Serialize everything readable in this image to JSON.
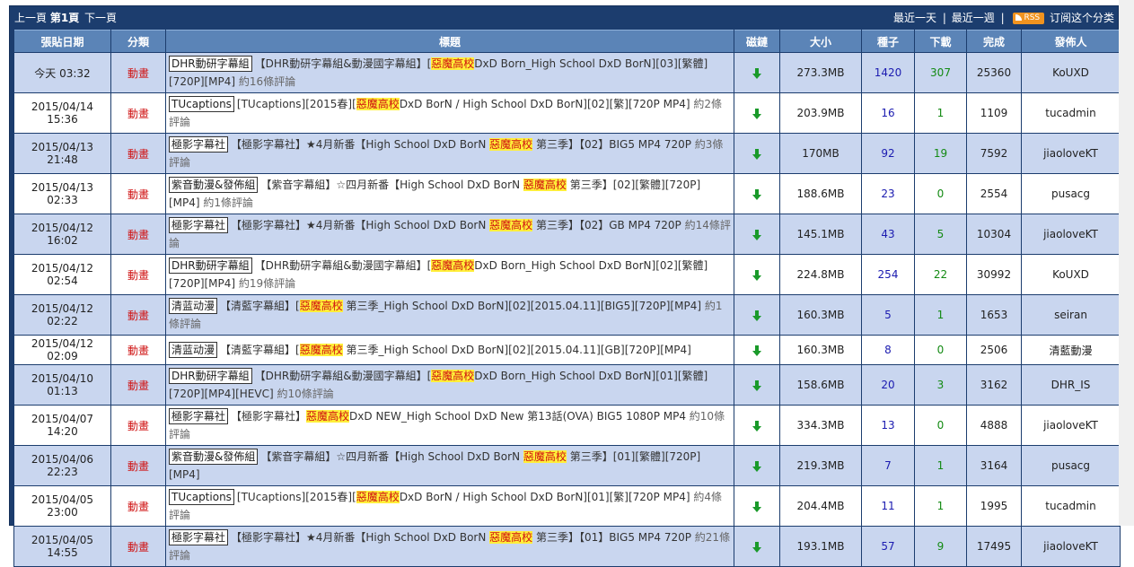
{
  "nav": {
    "prev": "上一頁",
    "page": "第1頁",
    "next": "下一頁",
    "recent_day": "最近一天",
    "divider": "|",
    "recent_week": "最近一週",
    "rss_label": "RSS",
    "subscribe": "订阅这个分类"
  },
  "columns": [
    "張貼日期",
    "分類",
    "標題",
    "磁鏈",
    "大小",
    "種子",
    "下載",
    "完成",
    "發佈人"
  ],
  "rows": [
    {
      "date": "今天 03:32",
      "cat": "動畫",
      "tag": "DHR動研字幕組",
      "pre": "【DHR動研字幕組&動漫國字幕組】[",
      "hl": "惡魔高校",
      "post": "DxD Born_High School DxD BorN][03][繁體][720P][MP4]",
      "cmt": "約16條評論",
      "size": "273.3MB",
      "seeds": "1420",
      "dls": "307",
      "done": "25360",
      "pub": "KoUXD"
    },
    {
      "date": "2015/04/14 15:36",
      "cat": "動畫",
      "tag": "TUcaptions",
      "pre": "[TUcaptions][2015春][",
      "hl": "惡魔高校",
      "post": "DxD BorN / High School DxD BorN][02][繁][720P MP4]",
      "cmt": "約2條評論",
      "size": "203.9MB",
      "seeds": "16",
      "dls": "1",
      "done": "1109",
      "pub": "tucadmin"
    },
    {
      "date": "2015/04/13 21:48",
      "cat": "動畫",
      "tag": "極影字幕社",
      "pre": "【極影字幕社】★4月新番【High School DxD BorN ",
      "hl": "惡魔高校",
      "post": " 第三季】【02】BIG5 MP4 720P",
      "cmt": "約3條評論",
      "size": "170MB",
      "seeds": "92",
      "dls": "19",
      "done": "7592",
      "pub": "jiaoloveKT"
    },
    {
      "date": "2015/04/13 02:33",
      "cat": "動畫",
      "tag": "紫音動漫&發佈組",
      "pre": "【紫音字幕組】☆四月新番【High School DxD BorN ",
      "hl": "惡魔高校",
      "post": " 第三季】[02][繁體][720P][MP4]",
      "cmt": "約1條評論",
      "size": "188.6MB",
      "seeds": "23",
      "dls": "0",
      "done": "2554",
      "pub": "pusacg"
    },
    {
      "date": "2015/04/12 16:02",
      "cat": "動畫",
      "tag": "極影字幕社",
      "pre": "【極影字幕社】★4月新番【High School DxD BorN ",
      "hl": "惡魔高校",
      "post": " 第三季】【02】GB MP4 720P",
      "cmt": "約14條評論",
      "size": "145.1MB",
      "seeds": "43",
      "dls": "5",
      "done": "10304",
      "pub": "jiaoloveKT"
    },
    {
      "date": "2015/04/12 02:54",
      "cat": "動畫",
      "tag": "DHR動研字幕組",
      "pre": "【DHR動研字幕組&動漫國字幕組】[",
      "hl": "惡魔高校",
      "post": "DxD Born_High School DxD BorN][02][繁體][720P][MP4]",
      "cmt": "約19條評論",
      "size": "224.8MB",
      "seeds": "254",
      "dls": "22",
      "done": "30992",
      "pub": "KoUXD"
    },
    {
      "date": "2015/04/12 02:22",
      "cat": "動畫",
      "tag": "清蓝动漫",
      "pre": "【清藍字幕組】[",
      "hl": "惡魔高校",
      "post": " 第三季_High School DxD BorN][02][2015.04.11][BIG5][720P][MP4]",
      "cmt": "約1條評論",
      "size": "160.3MB",
      "seeds": "5",
      "dls": "1",
      "done": "1653",
      "pub": "seiran"
    },
    {
      "date": "2015/04/12 02:09",
      "cat": "動畫",
      "tag": "清蓝动漫",
      "pre": "【清藍字幕組】[",
      "hl": "惡魔高校",
      "post": " 第三季_High School DxD BorN][02][2015.04.11][GB][720P][MP4]",
      "cmt": "",
      "size": "160.3MB",
      "seeds": "8",
      "dls": "0",
      "done": "2506",
      "pub": "清藍動漫"
    },
    {
      "date": "2015/04/10 01:13",
      "cat": "動畫",
      "tag": "DHR動研字幕組",
      "pre": "【DHR動研字幕組&動漫國字幕組】[",
      "hl": "惡魔高校",
      "post": "DxD Born_High School DxD BorN][01][繁體][720P][MP4][HEVC]",
      "cmt": "約10條評論",
      "size": "158.6MB",
      "seeds": "20",
      "dls": "3",
      "done": "3162",
      "pub": "DHR_IS"
    },
    {
      "date": "2015/04/07 14:20",
      "cat": "動畫",
      "tag": "極影字幕社",
      "pre": "【極影字幕社】",
      "hl": "惡魔高校",
      "post": "DxD NEW_High School DxD New 第13話(OVA) BIG5 1080P MP4",
      "cmt": "約10條評論",
      "size": "334.3MB",
      "seeds": "13",
      "dls": "0",
      "done": "4888",
      "pub": "jiaoloveKT"
    },
    {
      "date": "2015/04/06 22:23",
      "cat": "動畫",
      "tag": "紫音動漫&發佈組",
      "pre": "【紫音字幕組】☆四月新番【High School DxD BorN ",
      "hl": "惡魔高校",
      "post": " 第三季】[01][繁體][720P][MP4]",
      "cmt": "",
      "size": "219.3MB",
      "seeds": "7",
      "dls": "1",
      "done": "3164",
      "pub": "pusacg"
    },
    {
      "date": "2015/04/05 23:00",
      "cat": "動畫",
      "tag": "TUcaptions",
      "pre": "[TUcaptions][2015春][",
      "hl": "惡魔高校",
      "post": "DxD BorN / High School DxD BorN][01][繁][720P MP4]",
      "cmt": "約4條評論",
      "size": "204.4MB",
      "seeds": "11",
      "dls": "1",
      "done": "1995",
      "pub": "tucadmin"
    },
    {
      "date": "2015/04/05 14:55",
      "cat": "動畫",
      "tag": "極影字幕社",
      "pre": "【極影字幕社】★4月新番【High School DxD BorN ",
      "hl": "惡魔高校",
      "post": " 第三季】【01】BIG5 MP4 720P",
      "cmt": "約21條評論",
      "size": "193.1MB",
      "seeds": "57",
      "dls": "9",
      "done": "17495",
      "pub": "jiaoloveKT"
    }
  ]
}
